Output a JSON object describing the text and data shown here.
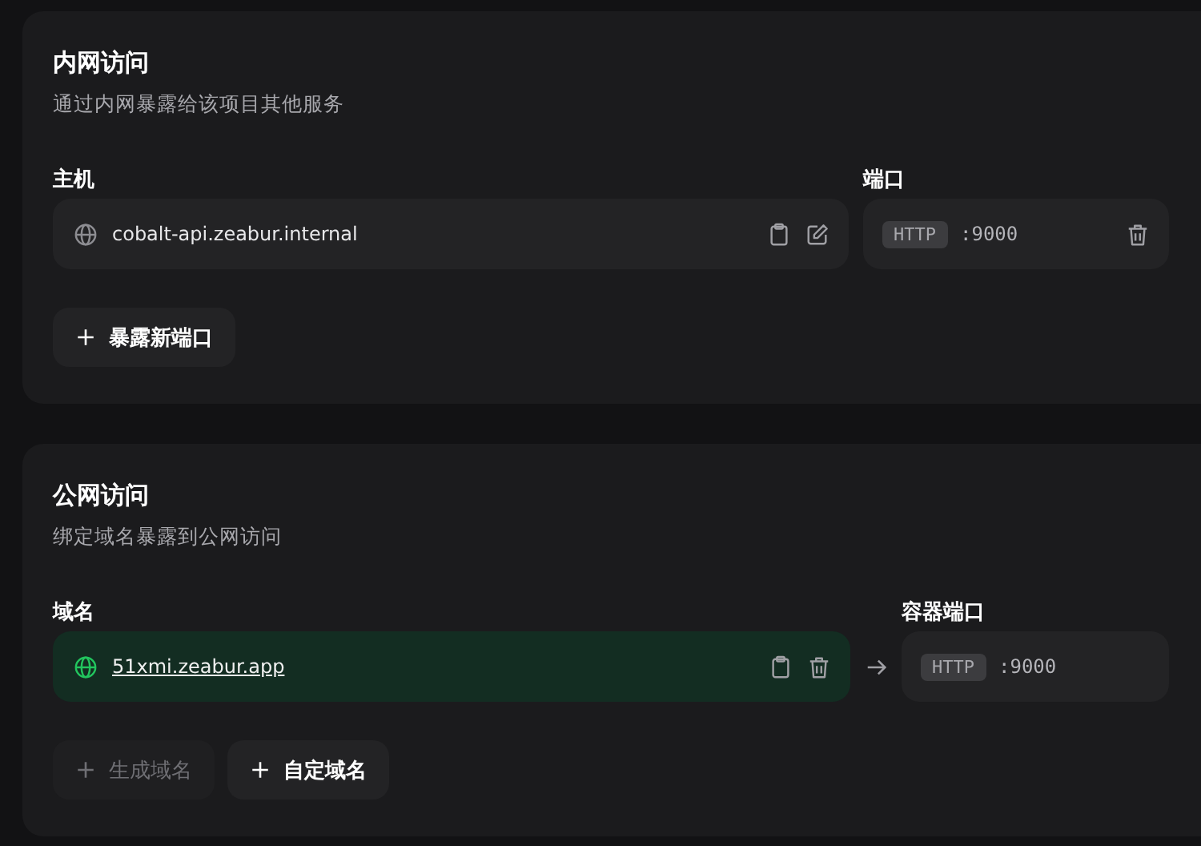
{
  "sections": [
    {
      "title": "内网访问",
      "subtitle": "通过内网暴露给该项目其他服务",
      "host_label": "主机",
      "port_label": "端口",
      "kind": "private",
      "host": {
        "text": "cobalt-api.zeabur.internal",
        "link": false,
        "actions": [
          {
            "kind": "copy"
          },
          {
            "kind": "edit"
          }
        ]
      },
      "port": {
        "protocol": "HTTP",
        "number": ":9000",
        "deletable": true
      },
      "buttons": [
        {
          "label": "暴露新端口",
          "disabled": false
        }
      ]
    },
    {
      "title": "公网访问",
      "subtitle": "绑定域名暴露到公网访问",
      "host_label": "域名",
      "port_label": "容器端口",
      "kind": "public",
      "host": {
        "text": "51xmi.zeabur.app",
        "link": true,
        "actions": [
          {
            "kind": "copy"
          },
          {
            "kind": "delete"
          }
        ]
      },
      "port": {
        "protocol": "HTTP",
        "number": ":9000",
        "deletable": false
      },
      "buttons": [
        {
          "label": "生成域名",
          "disabled": true
        },
        {
          "label": "自定域名",
          "disabled": false
        }
      ]
    }
  ]
}
